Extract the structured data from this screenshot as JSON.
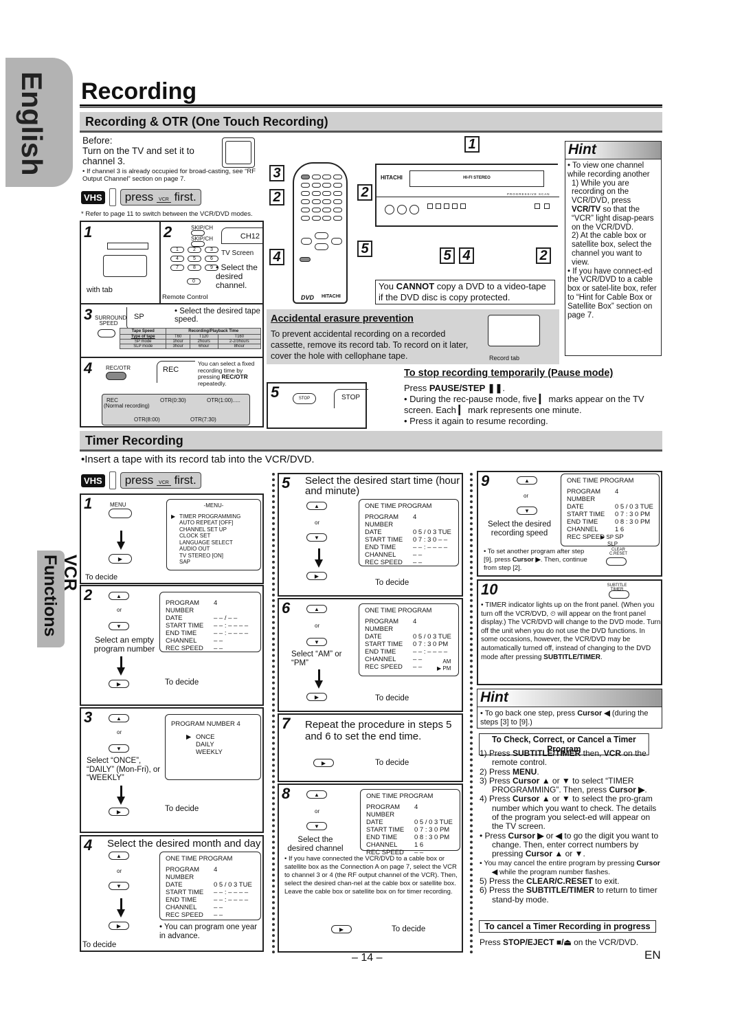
{
  "side_tabs": {
    "language": "English",
    "section": "VCR Functions"
  },
  "page": {
    "title": "Recording",
    "page_number": "– 14 –",
    "lang_code": "EN"
  },
  "otr": {
    "heading": "Recording & OTR (One Touch Recording)",
    "before_label": "Before:",
    "before_text": "Turn on the TV and set it to channel 3.",
    "before_note": "• If channel 3 is already occupied for broad-casting, see “RF Output Channel” section on page 7.",
    "vhs_badge": "VHS",
    "press_label": "press",
    "press_key": "VCR",
    "press_suffix": "first.",
    "mode_note": "* Refer to page 11 to switch between the VCR/DVD modes.",
    "step1": {
      "num": "1",
      "caption": "with tab"
    },
    "step2": {
      "num": "2",
      "skip_up": "SKIP/CH",
      "skip_down": "SKIP/CH",
      "keys": [
        "1",
        "2",
        "3",
        "4",
        "5",
        "6",
        "7",
        "8",
        "9",
        "0"
      ],
      "screen": "CH12",
      "screen_label": "TV Screen",
      "text": "• Select the desired channel.",
      "remote_label": "Remote Control"
    },
    "step3": {
      "num": "3",
      "button": "SURROUND SPEED",
      "screen": "SP",
      "text": "• Select the desired tape speed.",
      "table": {
        "header_left": "Tape Speed",
        "header_right": "Recording/Playback Time",
        "sub_header": [
          "Type of tape",
          "T60",
          "T120",
          "T160"
        ],
        "rows": [
          [
            "SP  mode",
            "1hour",
            "2hours",
            "2-2/3hours"
          ],
          [
            "SLP mode",
            "3hour",
            "6hour",
            "8hour"
          ]
        ]
      }
    },
    "step4": {
      "num": "4",
      "button": "REC/OTR",
      "screen": "REC",
      "text_pre": "You can select a fixed recording time by pressing ",
      "text_bold": "REC/OTR",
      "text_post": " repeatedly.",
      "cycle": {
        "rec": "REC",
        "rec_sub": "(Normal recording)",
        "otr1": "OTR(0:30)",
        "otr2": "OTR(1:00).....",
        "otr3": "OTR(7:30)",
        "otr4": "OTR(8:00)"
      }
    },
    "step5": {
      "num": "5",
      "button": "STOP",
      "screen": "STOP"
    },
    "remote_callouts": [
      "3",
      "2",
      "2",
      "4",
      "5"
    ],
    "device_callouts": [
      "1",
      "5",
      "4",
      "2"
    ],
    "device": {
      "brand": "HITACHI",
      "label": "HI-FI STEREO",
      "scan": "PROGRESSIVE SCAN"
    },
    "remote": {
      "brand": "HITACHI",
      "logo": "DVD"
    },
    "copy_note_pre": "You ",
    "copy_note_bold": "CANNOT",
    "copy_note_post": " copy a DVD to a video-tape if the DVD disc is copy protected.",
    "erasure": {
      "heading": "Accidental erasure prevention",
      "text": "To prevent accidental recording on a recorded cassette, remove its record tab. To record on it later, cover the hole with cellophane tape.",
      "tab_label": "Record tab"
    },
    "pause": {
      "heading": "To stop recording temporarily (Pause mode)",
      "press_pre": "Press ",
      "press_bold": "PAUSE/STEP ❚❚",
      "press_post": ".",
      "bullets": [
        "• During the rec-pause mode, five ▎ marks appear on the TV screen. Each ▎ mark represents one minute.",
        "• Press it again to resume recording."
      ]
    },
    "hint": {
      "title": "Hint",
      "items": [
        "• To view one channel while recording another",
        "1) While you are recording on the VCR/DVD, press",
        "VCR/TV",
        " so that the “VCR” light disap-pears on the VCR/DVD.",
        "2) At the cable box or satellite box, select the channel you want to view.",
        "• If you have connect-ed the VCR/DVD to a cable box or satel-lite box, refer to “Hint for Cable Box or Satellite Box” section on page 7."
      ]
    }
  },
  "timer": {
    "heading": "Timer Recording",
    "intro": "•Insert a tape with its record tab into the VCR/DVD.",
    "vhs_badge": "VHS",
    "press_label": "press",
    "press_key": "VCR",
    "press_suffix": "first.",
    "to_decide": "To decide",
    "or": "or",
    "step1": {
      "num": "1",
      "button": "MENU",
      "menu_title": "-MENU-",
      "menu_items": [
        "TIMER PROGRAMMING",
        "AUTO REPEAT  [OFF]",
        "CHANNEL SET UP",
        "CLOCK SET",
        "LANGUAGE SELECT",
        "AUDIO OUT",
        "TV STEREO      [ON]",
        "SAP"
      ]
    },
    "step2": {
      "num": "2",
      "caption": "Select an empty program number",
      "screen": [
        [
          "PROGRAM NUMBER",
          "4"
        ],
        [
          "DATE",
          "– – / – –"
        ],
        [
          "START TIME",
          "– – : – –  – –"
        ],
        [
          "END    TIME",
          "– – : – –  – –"
        ],
        [
          "CHANNEL",
          "– –"
        ],
        [
          "REC SPEED",
          "– –"
        ]
      ]
    },
    "step3": {
      "num": "3",
      "caption": "Select “ONCE”, “DAILY” (Mon-Fri), or “WEEKLY”",
      "screen_title": "PROGRAM  NUMBER  4",
      "options": [
        "ONCE",
        "DAILY",
        "WEEKLY"
      ]
    },
    "step4": {
      "num": "4",
      "heading": "Select the desired month and day",
      "screen_title": "ONE TIME PROGRAM",
      "screen": [
        [
          "PROGRAM NUMBER",
          "4"
        ],
        [
          "DATE",
          "0 5 / 0 3  TUE"
        ],
        [
          "START TIME",
          "– – : – –  – –"
        ],
        [
          "END    TIME",
          "– – : – –  – –"
        ],
        [
          "CHANNEL",
          "– –"
        ],
        [
          "REC SPEED",
          "– –"
        ]
      ],
      "note": "• You can program one year in advance."
    },
    "step5": {
      "num": "5",
      "heading": "Select the desired start time (hour and minute)",
      "screen_title": "ONE TIME PROGRAM",
      "screen": [
        [
          "PROGRAM NUMBER",
          "4"
        ],
        [
          "DATE",
          "0 5 / 0 3  TUE"
        ],
        [
          "START TIME",
          "0 7 : 3 0  – –"
        ],
        [
          "END    TIME",
          "– – : – –  – –"
        ],
        [
          "CHANNEL",
          "– –"
        ],
        [
          "REC SPEED",
          "– –"
        ]
      ]
    },
    "step6": {
      "num": "6",
      "caption": "Select “AM” or “PM”",
      "screen_title": "ONE TIME PROGRAM",
      "screen": [
        [
          "PROGRAM NUMBER",
          "4"
        ],
        [
          "DATE",
          "0 5 / 0 3  TUE"
        ],
        [
          "START TIME",
          "0 7 : 3 0  PM"
        ],
        [
          "END    TIME",
          "– – : – –  – –"
        ],
        [
          "CHANNEL",
          "– –"
        ],
        [
          "REC SPEED",
          "– –"
        ]
      ],
      "options": [
        "AM",
        "PM"
      ]
    },
    "step7": {
      "num": "7",
      "heading": "Repeat the procedure in steps 5 and 6 to set the end time."
    },
    "step8": {
      "num": "8",
      "caption": "Select the desired channel",
      "screen_title": "ONE TIME PROGRAM",
      "screen": [
        [
          "PROGRAM NUMBER",
          "4"
        ],
        [
          "DATE",
          "0 5 / 0 3  TUE"
        ],
        [
          "START TIME",
          "0 7 : 3 0  PM"
        ],
        [
          "END    TIME",
          "0 8 : 3 0  PM"
        ],
        [
          "CHANNEL",
          "1 6"
        ],
        [
          "REC SPEED",
          "– –"
        ]
      ],
      "note": "• If you have connected the VCR/DVD to a cable box or satellite box as the Connection A on page 7, select the VCR to channel 3 or 4 (the RF output channel of the VCR). Then, select the desired chan-nel at the cable box or satellite box. Leave the cable box or satellite box on for timer recording."
    },
    "step9": {
      "num": "9",
      "caption": "Select the desired recording speed",
      "screen_title": "ONE TIME PROGRAM",
      "screen": [
        [
          "PROGRAM NUMBER",
          "4"
        ],
        [
          "DATE",
          "0 5 / 0 3  TUE"
        ],
        [
          "START TIME",
          "0 7 : 3 0  PM"
        ],
        [
          "END    TIME",
          "0 8 : 3 0  PM"
        ],
        [
          "CHANNEL",
          "1 6"
        ],
        [
          "REC SPEED",
          "SP"
        ]
      ],
      "options": [
        "SP",
        "SLP"
      ],
      "note_pre": "• To set another program after step [9], press ",
      "note_bold": "Cursor ▶",
      "note_post": ". Then, continue from step [2].",
      "button": "CLEAR C.RESET"
    },
    "step10": {
      "num": "10",
      "button": "SUBTITLE TIMER",
      "text_pre": "• TIMER indicator lights up on the front panel. (When you turn off the VCR/DVD, ⏲ will appear on the front panel display.) The VCR/DVD will change to the DVD mode. Turn off the unit when you do not use the DVD functions. In some occasions, however, the VCR/DVD may be automatically turned off, instead of changing to the DVD mode after pressing ",
      "text_bold": "SUBTITLE/TIMER",
      "text_post": "."
    },
    "hint": {
      "title": "Hint",
      "text_pre": "• To go back one step, press ",
      "text_bold": "Cursor ◀",
      "text_post": " (during the steps [3] to [9].)"
    },
    "check": {
      "heading": "To Check, Correct, or Cancel a Timer Program",
      "items": [
        "1) Press <b>SUBTITLE/TIMER</b> then, <b>VCR</b> on the remote control.",
        "2) Press <b>MENU</b>.",
        "3) Press <b>Cursor ▲</b> or <b>▼</b> to select “TIMER PROGRAMMING”. Then, press <b>Cursor ▶</b>.",
        "4) Press <b>Cursor ▲</b> or <b>▼</b> to select the pro-gram number which you want to check. The details of the program you select-ed will appear on the TV screen.",
        "• Press <b>Cursor ▶</b> or <b>◀</b> to go the digit you want to change. Then, enter correct numbers by pressing <b>Cursor ▲</b> or <b>▼</b>.",
        "• You may cancel the entire program by pressing <b>Cursor ◀</b> while the program number flashes.",
        "5) Press the <b>CLEAR/C.RESET</b> to exit.",
        "6) Press the <b>SUBTITLE/TIMER</b> to return to timer stand-by mode."
      ]
    },
    "cancel": {
      "heading": "To cancel a Timer Recording in progress",
      "text_pre": "Press ",
      "text_bold": "STOP/EJECT ■/⏏",
      "text_post": " on the VCR/DVD."
    }
  }
}
